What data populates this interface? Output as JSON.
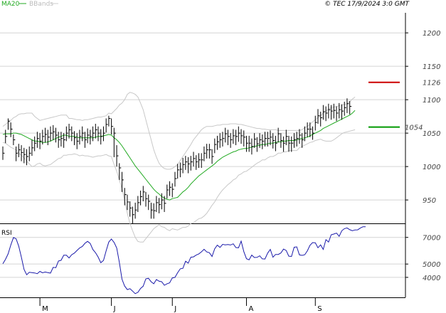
{
  "chart_data": {
    "type": "ohlc",
    "legend": [
      {
        "label": "MA20",
        "color": "#22aa22"
      },
      {
        "label": "BBands",
        "color": "#bbbbbb"
      }
    ],
    "source_label": "© TEC 17/9/2024 3:0 GMT",
    "price_axis": {
      "ticks": [
        950,
        1000,
        1050,
        1100,
        1150,
        1200
      ],
      "range": [
        915,
        1230
      ]
    },
    "rsi_axis": {
      "ticks": [
        4000,
        5000,
        7000
      ],
      "range": [
        2500,
        8000
      ]
    },
    "x_axis": {
      "categories": [
        "M",
        "J",
        "J",
        "A",
        "S"
      ],
      "range": [
        0,
        137
      ]
    },
    "month_indices": [
      14,
      41,
      64,
      92,
      118
    ],
    "price_markers": [
      {
        "label": "1126",
        "value": 1126,
        "color": "#cc0000"
      },
      {
        "label": "1054",
        "value": 1059,
        "color": "#009900"
      }
    ],
    "panel_labels": {
      "rsi": "RSI"
    },
    "series": [
      {
        "name": "close",
        "values": [
          1020,
          1045,
          1068,
          1056,
          1040,
          1020,
          1025,
          1021,
          1018,
          1015,
          1020,
          1028,
          1035,
          1042,
          1038,
          1045,
          1048,
          1044,
          1050,
          1052,
          1047,
          1040,
          1042,
          1040,
          1050,
          1055,
          1050,
          1043,
          1038,
          1045,
          1050,
          1040,
          1047,
          1045,
          1050,
          1055,
          1050,
          1045,
          1050,
          1063,
          1072,
          1060,
          1050,
          1016,
          998,
          980,
          958,
          947,
          938,
          928,
          935,
          946,
          955,
          962,
          952,
          948,
          935,
          934,
          946,
          943,
          950,
          945,
          965,
          969,
          966,
          982,
          995,
          996,
          1003,
          1007,
          1004,
          1007,
          1012,
          1007,
          1010,
          1010,
          1020,
          1025,
          1025,
          1015,
          1033,
          1037,
          1040,
          1042,
          1049,
          1045,
          1040,
          1046,
          1045,
          1050,
          1046,
          1044,
          1035,
          1035,
          1030,
          1041,
          1034,
          1040,
          1038,
          1042,
          1042,
          1044,
          1039,
          1035,
          1049,
          1039,
          1035,
          1045,
          1035,
          1035,
          1040,
          1042,
          1047,
          1040,
          1050,
          1056,
          1056,
          1050,
          1066,
          1076,
          1073,
          1082,
          1080,
          1085,
          1083,
          1084,
          1080,
          1085,
          1083,
          1088,
          1094,
          1090
        ]
      },
      {
        "name": "MA20",
        "values": [
          1048,
          1049,
          1049,
          1049,
          1050,
          1050,
          1049,
          1048,
          1046,
          1044,
          1042,
          1040,
          1038,
          1038,
          1037,
          1036,
          1036,
          1037,
          1038,
          1040,
          1042,
          1044,
          1045,
          1047,
          1047,
          1045,
          1045,
          1045,
          1044,
          1043,
          1043,
          1043,
          1043,
          1043,
          1043,
          1044,
          1045,
          1045,
          1046,
          1047,
          1048,
          1047,
          1043,
          1040,
          1036,
          1031,
          1025,
          1019,
          1013,
          1007,
          1001,
          996,
          991,
          986,
          981,
          976,
          971,
          966,
          962,
          959,
          955,
          953,
          951,
          950,
          952,
          953,
          954,
          958,
          962,
          965,
          969,
          974,
          978,
          982,
          986,
          989,
          992,
          995,
          998,
          1001,
          1004,
          1008,
          1011,
          1014,
          1016,
          1018,
          1020,
          1022,
          1023,
          1025,
          1026,
          1027,
          1027,
          1028,
          1029,
          1030,
          1031,
          1032,
          1033,
          1033,
          1034,
          1035,
          1035,
          1036,
          1037,
          1037,
          1038,
          1038,
          1039,
          1039,
          1039,
          1040,
          1041,
          1042,
          1043,
          1044,
          1046,
          1048,
          1050,
          1052,
          1054,
          1057,
          1059,
          1061,
          1063,
          1065,
          1067,
          1069,
          1071,
          1073,
          1075,
          1077,
          1080,
          1084
        ]
      },
      {
        "name": "BBands-upper",
        "values": [
          1060,
          1063,
          1066,
          1069,
          1073,
          1075,
          1078,
          1079,
          1079,
          1080,
          1080,
          1080,
          1075,
          1072,
          1069,
          1070,
          1071,
          1072,
          1073,
          1074,
          1075,
          1076,
          1077,
          1077,
          1077,
          1072,
          1072,
          1071,
          1070,
          1070,
          1069,
          1070,
          1070,
          1071,
          1072,
          1073,
          1074,
          1074,
          1075,
          1076,
          1080,
          1079,
          1083,
          1087,
          1092,
          1095,
          1100,
          1108,
          1111,
          1110,
          1108,
          1104,
          1095,
          1085,
          1070,
          1055,
          1040,
          1025,
          1014,
          1005,
          1000,
          997,
          996,
          996,
          997,
          1000,
          1003,
          1009,
          1015,
          1021,
          1027,
          1033,
          1040,
          1045,
          1050,
          1055,
          1058,
          1060,
          1060,
          1060,
          1061,
          1062,
          1062,
          1063,
          1063,
          1063,
          1064,
          1064,
          1064,
          1063,
          1063,
          1062,
          1061,
          1060,
          1059,
          1058,
          1057,
          1057,
          1056,
          1056,
          1055,
          1055,
          1055,
          1055,
          1054,
          1054,
          1054,
          1054,
          1054,
          1054,
          1054,
          1054,
          1054,
          1055,
          1058,
          1060,
          1063,
          1067,
          1070,
          1073,
          1076,
          1080,
          1083,
          1086,
          1088,
          1089,
          1090,
          1091,
          1092,
          1093,
          1094,
          1097,
          1101,
          1104
        ]
      },
      {
        "name": "BBands-lower",
        "values": [
          1036,
          1035,
          1032,
          1029,
          1027,
          1025,
          1020,
          1017,
          1013,
          1008,
          1004,
          1000,
          1001,
          1004,
          1005,
          1002,
          1001,
          1002,
          1003,
          1006,
          1009,
          1012,
          1013,
          1017,
          1017,
          1018,
          1018,
          1019,
          1018,
          1016,
          1017,
          1016,
          1016,
          1015,
          1014,
          1015,
          1016,
          1016,
          1017,
          1018,
          1016,
          1015,
          1003,
          993,
          980,
          967,
          950,
          930,
          915,
          904,
          894,
          888,
          887,
          887,
          892,
          897,
          902,
          907,
          910,
          913,
          910,
          909,
          906,
          904,
          907,
          906,
          905,
          907,
          909,
          909,
          911,
          915,
          916,
          919,
          922,
          923,
          926,
          930,
          936,
          942,
          947,
          954,
          960,
          965,
          969,
          973,
          976,
          980,
          982,
          987,
          989,
          992,
          993,
          996,
          999,
          1002,
          1005,
          1007,
          1010,
          1010,
          1013,
          1015,
          1015,
          1017,
          1020,
          1020,
          1022,
          1022,
          1024,
          1024,
          1024,
          1024,
          1028,
          1030,
          1032,
          1034,
          1036,
          1037,
          1039,
          1040,
          1041,
          1039,
          1038,
          1038,
          1038,
          1040,
          1043,
          1046,
          1049,
          1051,
          1052,
          1053,
          1054,
          1055
        ]
      },
      {
        "name": "RSI",
        "values": [
          5020,
          5350,
          5760,
          6430,
          6990,
          6900,
          6350,
          5500,
          4600,
          4200,
          4380,
          4360,
          4330,
          4280,
          4450,
          4340,
          4400,
          4360,
          4320,
          4750,
          4730,
          5230,
          5280,
          5660,
          5660,
          5460,
          5700,
          5820,
          6020,
          6210,
          6320,
          6560,
          6700,
          6550,
          6090,
          5850,
          5520,
          5100,
          5270,
          5990,
          6650,
          6880,
          6620,
          6200,
          5120,
          3860,
          3350,
          3080,
          3150,
          2970,
          2780,
          2880,
          3170,
          3340,
          3890,
          3930,
          3670,
          3520,
          3840,
          3710,
          3670,
          3410,
          3520,
          3590,
          3960,
          4000,
          4350,
          4640,
          4680,
          5210,
          5070,
          5510,
          5540,
          5670,
          5760,
          5920,
          6110,
          5910,
          5850,
          5570,
          6140,
          6420,
          6250,
          6480,
          6440,
          6460,
          6430,
          6520,
          6240,
          6220,
          6720,
          5930,
          5400,
          5320,
          5670,
          5490,
          5500,
          5620,
          5390,
          5380,
          5820,
          6100,
          5510,
          5720,
          5720,
          5830,
          6120,
          6020,
          5590,
          5570,
          6260,
          6290,
          5690,
          5650,
          5700,
          5990,
          6410,
          6610,
          6590,
          6220,
          6440,
          6100,
          6830,
          6650,
          7200,
          7250,
          7320,
          7080,
          7500,
          7660,
          7710,
          7580,
          7500,
          7560,
          7570,
          7700,
          7800,
          7800
        ]
      }
    ],
    "ohlc_low": [
      1010,
      1035,
      1055,
      1044,
      1032,
      1008,
      1014,
      1008,
      1005,
      1002,
      1008,
      1016,
      1023,
      1028,
      1026,
      1033,
      1036,
      1032,
      1038,
      1040,
      1036,
      1028,
      1030,
      1028,
      1038,
      1042,
      1038,
      1032,
      1026,
      1033,
      1038,
      1028,
      1035,
      1033,
      1038,
      1042,
      1038,
      1033,
      1038,
      1051,
      1060,
      1048,
      1014,
      1000,
      980,
      962,
      942,
      935,
      925,
      915,
      922,
      932,
      942,
      948,
      940,
      935,
      922,
      922,
      932,
      930,
      936,
      932,
      952,
      956,
      954,
      970,
      982,
      984,
      990,
      995,
      990,
      994,
      1000,
      995,
      998,
      998,
      1008,
      1012,
      1012,
      1004,
      1020,
      1025,
      1028,
      1030,
      1036,
      1032,
      1028,
      1034,
      1032,
      1037,
      1034,
      1030,
      1022,
      1022,
      1018,
      1028,
      1022,
      1028,
      1026,
      1030,
      1030,
      1032,
      1027,
      1023,
      1036,
      1028,
      1022,
      1032,
      1022,
      1022,
      1028,
      1030,
      1034,
      1028,
      1038,
      1044,
      1044,
      1040,
      1054,
      1064,
      1060,
      1070,
      1068,
      1072,
      1070,
      1072,
      1068,
      1072,
      1070,
      1076,
      1080,
      1078
    ],
    "ohlc_high": [
      1030,
      1055,
      1072,
      1066,
      1048,
      1030,
      1034,
      1032,
      1028,
      1026,
      1030,
      1040,
      1045,
      1052,
      1050,
      1055,
      1058,
      1055,
      1060,
      1062,
      1058,
      1052,
      1052,
      1050,
      1060,
      1064,
      1060,
      1053,
      1050,
      1055,
      1060,
      1052,
      1057,
      1055,
      1060,
      1064,
      1060,
      1056,
      1060,
      1072,
      1076,
      1072,
      1058,
      1032,
      1005,
      992,
      968,
      958,
      948,
      940,
      946,
      956,
      964,
      971,
      962,
      958,
      946,
      945,
      956,
      953,
      960,
      956,
      973,
      978,
      975,
      992,
      1004,
      1006,
      1013,
      1016,
      1014,
      1016,
      1022,
      1017,
      1020,
      1020,
      1030,
      1034,
      1034,
      1026,
      1042,
      1046,
      1050,
      1052,
      1058,
      1055,
      1050,
      1056,
      1055,
      1060,
      1056,
      1054,
      1046,
      1046,
      1042,
      1050,
      1044,
      1050,
      1048,
      1052,
      1052,
      1054,
      1050,
      1046,
      1058,
      1050,
      1045,
      1055,
      1046,
      1045,
      1050,
      1052,
      1056,
      1050,
      1060,
      1066,
      1066,
      1060,
      1076,
      1086,
      1082,
      1092,
      1090,
      1094,
      1092,
      1094,
      1090,
      1095,
      1093,
      1097,
      1102,
      1098
    ]
  }
}
